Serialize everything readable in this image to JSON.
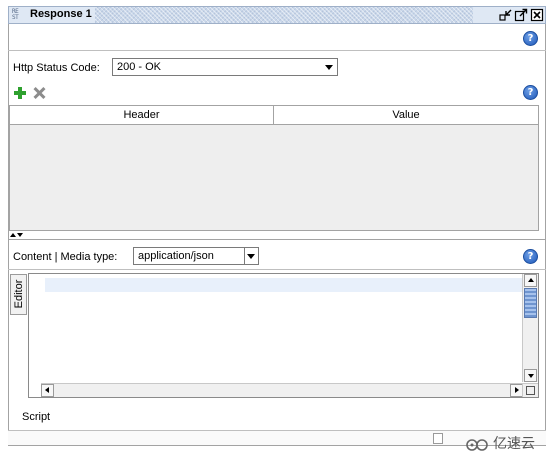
{
  "window": {
    "title": "Response 1",
    "icon": "rest-icon",
    "controls": [
      "minimize-icon",
      "maximize-icon",
      "close-icon"
    ]
  },
  "status_code": {
    "label": "Http Status Code:",
    "selected": "200 - OK"
  },
  "headers_toolbar": {
    "add_icon": "plus-icon",
    "remove_icon": "x-icon"
  },
  "headers_table": {
    "columns": [
      "Header",
      "Value"
    ],
    "rows": []
  },
  "content": {
    "label": "Content | Media type:",
    "media_type": "application/json",
    "editor_tab": "Editor"
  },
  "script": {
    "label": "Script"
  },
  "watermark": {
    "text": "亿速云"
  },
  "colors": {
    "accent_green": "#2ea02e",
    "help_blue": "#1d57b8",
    "titlebar": "#c9d7ea"
  }
}
